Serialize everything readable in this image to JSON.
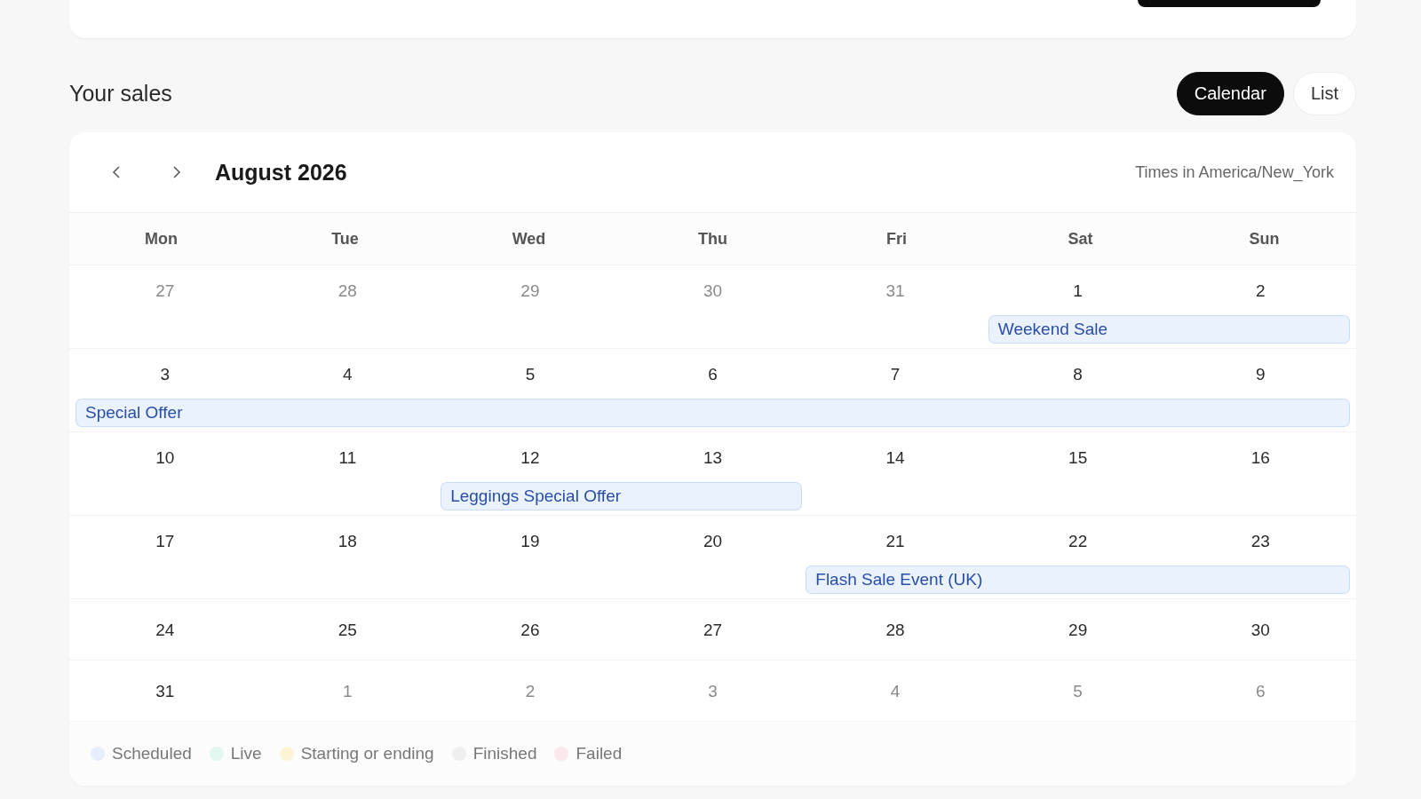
{
  "title": "Your sales",
  "view_toggle": [
    {
      "label": "Calendar",
      "selected": true
    },
    {
      "label": "List",
      "selected": false
    }
  ],
  "calendar": {
    "month": "August 2026",
    "timezone": "Times in America/New_York",
    "weekdays": [
      "Mon",
      "Tue",
      "Wed",
      "Thu",
      "Fri",
      "Sat",
      "Sun"
    ],
    "weeks": [
      {
        "sale": "Weekend Sale",
        "days": [
          {
            "num": "27",
            "muted": true,
            "in_sale": false
          },
          {
            "num": "28",
            "muted": true,
            "in_sale": false
          },
          {
            "num": "29",
            "muted": true,
            "in_sale": false
          },
          {
            "num": "30",
            "muted": true,
            "in_sale": false
          },
          {
            "num": "31",
            "muted": true,
            "in_sale": false
          },
          {
            "num": "1",
            "muted": false,
            "in_sale": true
          },
          {
            "num": "2",
            "muted": false,
            "in_sale": true
          }
        ]
      },
      {
        "sale": "Special Offer",
        "days": [
          {
            "num": "3",
            "muted": false,
            "in_sale": true
          },
          {
            "num": "4",
            "muted": false,
            "in_sale": true
          },
          {
            "num": "5",
            "muted": false,
            "in_sale": true
          },
          {
            "num": "6",
            "muted": false,
            "in_sale": true
          },
          {
            "num": "7",
            "muted": false,
            "in_sale": true
          },
          {
            "num": "8",
            "muted": false,
            "in_sale": true
          },
          {
            "num": "9",
            "muted": false,
            "in_sale": true
          }
        ]
      },
      {
        "sale": "Leggings Special Offer",
        "days": [
          {
            "num": "10",
            "muted": false,
            "in_sale": false
          },
          {
            "num": "11",
            "muted": false,
            "in_sale": false
          },
          {
            "num": "12",
            "muted": false,
            "in_sale": true
          },
          {
            "num": "13",
            "muted": false,
            "in_sale": true
          },
          {
            "num": "14",
            "muted": false,
            "in_sale": false
          },
          {
            "num": "15",
            "muted": false,
            "in_sale": false
          },
          {
            "num": "16",
            "muted": false,
            "in_sale": false
          }
        ]
      },
      {
        "sale": "Flash Sale Event (UK)",
        "days": [
          {
            "num": "17",
            "muted": false,
            "in_sale": false
          },
          {
            "num": "18",
            "muted": false,
            "in_sale": false
          },
          {
            "num": "19",
            "muted": false,
            "in_sale": false
          },
          {
            "num": "20",
            "muted": false,
            "in_sale": false
          },
          {
            "num": "21",
            "muted": false,
            "in_sale": true
          },
          {
            "num": "22",
            "muted": false,
            "in_sale": true
          },
          {
            "num": "23",
            "muted": false,
            "in_sale": true
          }
        ]
      },
      {
        "days": [
          {
            "num": "24",
            "muted": false,
            "in_sale": false
          },
          {
            "num": "25",
            "muted": false,
            "in_sale": false
          },
          {
            "num": "26",
            "muted": false,
            "in_sale": false
          },
          {
            "num": "27",
            "muted": false,
            "in_sale": false
          },
          {
            "num": "28",
            "muted": false,
            "in_sale": false
          },
          {
            "num": "29",
            "muted": false,
            "in_sale": false
          },
          {
            "num": "30",
            "muted": false,
            "in_sale": false
          }
        ]
      },
      {
        "days": [
          {
            "num": "31",
            "muted": false,
            "in_sale": false
          },
          {
            "num": "1",
            "muted": true,
            "in_sale": false
          },
          {
            "num": "2",
            "muted": true,
            "in_sale": false
          },
          {
            "num": "3",
            "muted": true,
            "in_sale": false
          },
          {
            "num": "4",
            "muted": true,
            "in_sale": false
          },
          {
            "num": "5",
            "muted": true,
            "in_sale": false
          },
          {
            "num": "6",
            "muted": true,
            "in_sale": false
          }
        ]
      }
    ]
  },
  "legend": [
    {
      "label": "Scheduled",
      "color": "#e6effc"
    },
    {
      "label": "Live",
      "color": "#e2f7ef"
    },
    {
      "label": "Starting or ending",
      "color": "#fdf4d8"
    },
    {
      "label": "Finished",
      "color": "#efefef"
    },
    {
      "label": "Failed",
      "color": "#fce8ea"
    }
  ]
}
